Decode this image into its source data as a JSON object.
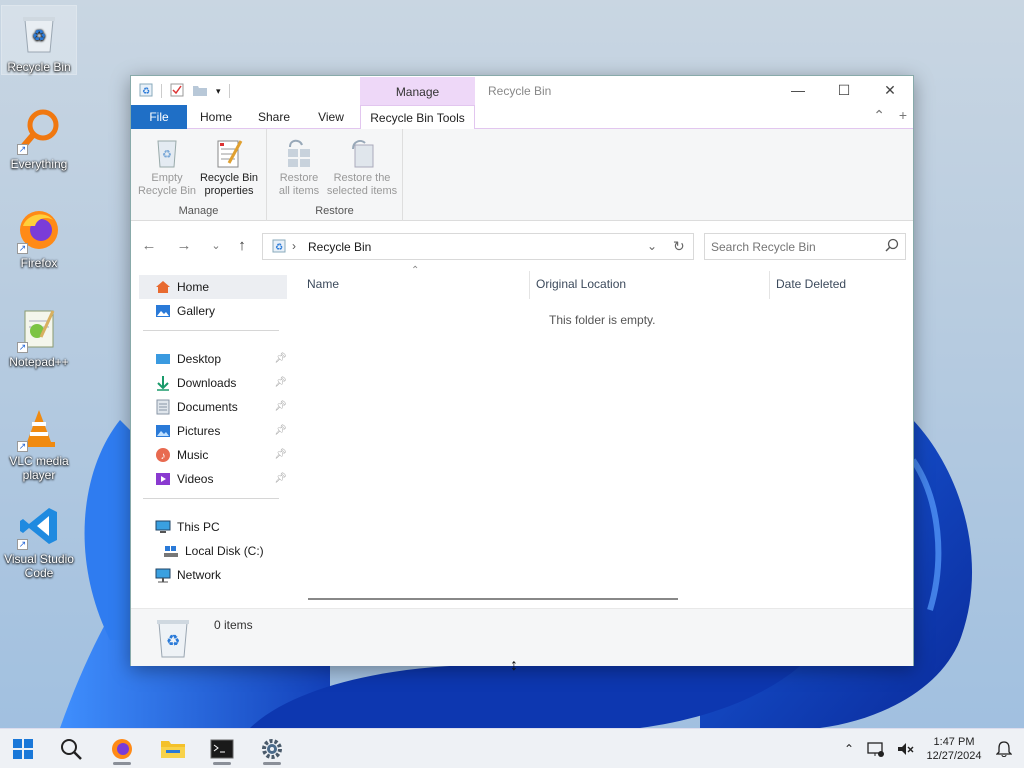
{
  "desktop": {
    "icons": [
      {
        "label": "Recycle Bin",
        "icon": "recycle-bin-icon"
      },
      {
        "label": "Everything",
        "icon": "everything-search-icon"
      },
      {
        "label": "Firefox",
        "icon": "firefox-icon"
      },
      {
        "label": "Notepad++",
        "icon": "notepad-plus-plus-icon"
      },
      {
        "label": "VLC media player",
        "icon": "vlc-cone-icon"
      },
      {
        "label": "Visual Studio Code",
        "icon": "vscode-icon"
      }
    ]
  },
  "window": {
    "title": "Recycle Bin",
    "context_group": "Manage",
    "tabs": {
      "file": "File",
      "home": "Home",
      "share": "Share",
      "view": "View",
      "tools": "Recycle Bin Tools"
    },
    "ribbon": {
      "manage": {
        "label": "Manage",
        "empty_l1": "Empty",
        "empty_l2": "Recycle Bin",
        "props_l1": "Recycle Bin",
        "props_l2": "properties"
      },
      "restore": {
        "label": "Restore",
        "all_l1": "Restore",
        "all_l2": "all items",
        "sel_l1": "Restore the",
        "sel_l2": "selected items"
      }
    },
    "address": {
      "path": "Recycle Bin"
    },
    "search": {
      "placeholder": "Search Recycle Bin"
    },
    "sidebar": {
      "home": "Home",
      "gallery": "Gallery",
      "desktop": "Desktop",
      "downloads": "Downloads",
      "documents": "Documents",
      "pictures": "Pictures",
      "music": "Music",
      "videos": "Videos",
      "this_pc": "This PC",
      "local_disk": "Local Disk (C:)",
      "network": "Network"
    },
    "columns": {
      "name": "Name",
      "original_location": "Original Location",
      "date_deleted": "Date Deleted"
    },
    "empty_message": "This folder is empty.",
    "status": {
      "items": "0 items"
    }
  },
  "taskbar": {
    "time": "1:47 PM",
    "date": "12/27/2024"
  },
  "colors": {
    "accent": "#1f6fc6",
    "context_tab": "#eed8f8"
  }
}
